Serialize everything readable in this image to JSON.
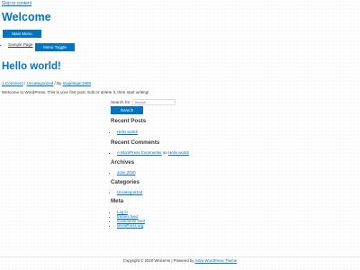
{
  "skip_link": "Skip to content",
  "site_title": "Welcome",
  "main_menu_label": "Main Menu",
  "menu_toggle_label": "Menu Toggle",
  "nav": {
    "items": [
      {
        "label": "Sample Page"
      }
    ]
  },
  "post": {
    "title": "Hello world!",
    "comments": "1 Comment",
    "sep1": " / ",
    "category": "Uncategorized",
    "sep2": " / By ",
    "author": "stagesiger1989",
    "content": "Welcome to WordPress. This is your first post. Edit or delete it, then start writing!"
  },
  "search": {
    "label": "Search for:",
    "placeholder": "Search ...",
    "button": "Search"
  },
  "widgets": {
    "recent_posts": {
      "title": "Recent Posts",
      "items": [
        "Hello world!"
      ]
    },
    "recent_comments": {
      "title": "Recent Comments",
      "commenter": "A WordPress Commenter",
      "on": " on ",
      "post": "Hello world!"
    },
    "archives": {
      "title": "Archives",
      "items": [
        "June 2020"
      ]
    },
    "categories": {
      "title": "Categories",
      "items": [
        "Uncategorized"
      ]
    },
    "meta": {
      "title": "Meta",
      "items": [
        "Log in",
        "Entries feed",
        "Comments feed",
        "WordPress.org"
      ]
    }
  },
  "footer": {
    "text": "Copyright © 2020 Welcome | Powered by ",
    "link": "Astra WordPress Theme"
  },
  "colors": {
    "accent": "#0274be",
    "text": "#3a3a3a"
  }
}
